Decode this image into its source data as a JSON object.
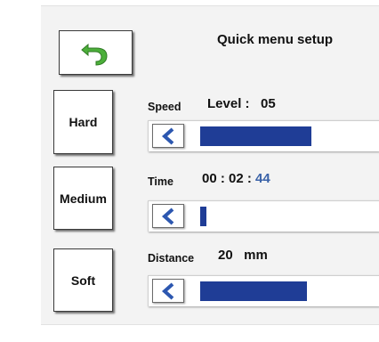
{
  "header": {
    "title": "Quick menu setup",
    "back_icon": "back-arrow-icon"
  },
  "presets": [
    {
      "label": "Hard"
    },
    {
      "label": "Medium"
    },
    {
      "label": "Soft"
    }
  ],
  "speed": {
    "label": "Speed",
    "value_text": "Level :   05",
    "level_fraction": 0.52
  },
  "time": {
    "label": "Time",
    "value_main": "00 : 02 : ",
    "value_seconds": "44",
    "level_fraction": 0.03
  },
  "distance": {
    "label": "Distance",
    "value_text": "20   mm",
    "level_fraction": 0.5
  },
  "colors": {
    "accent": "#3a62a8",
    "bar_fill": "#1f3d96",
    "back_arrow": "#4caf3a"
  }
}
